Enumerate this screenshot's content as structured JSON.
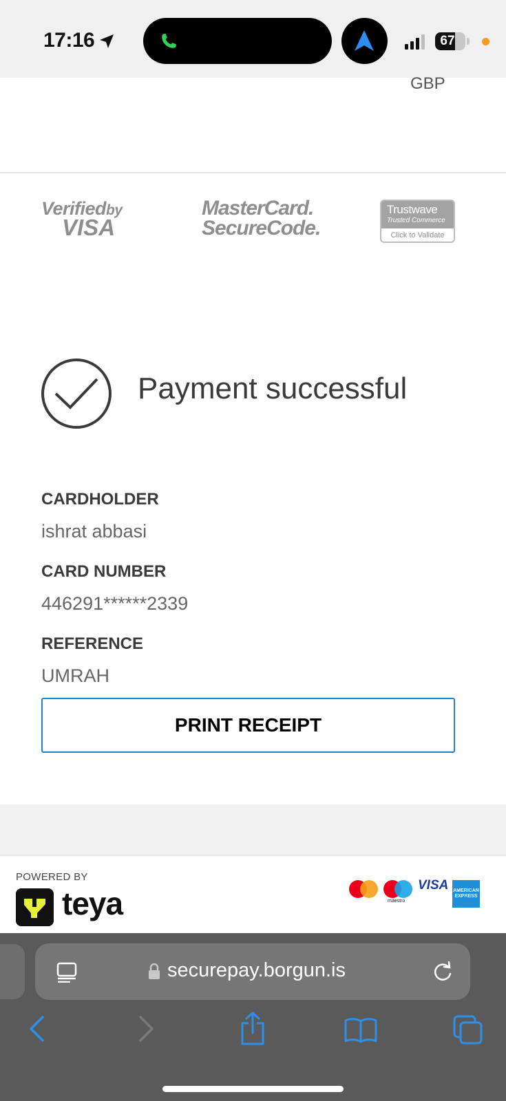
{
  "status_bar": {
    "time": "17:16",
    "battery": "67",
    "battery_level": 0.67,
    "icons": [
      "location-arrow-icon",
      "phone-icon",
      "navigation-icon",
      "signal-icon",
      "battery-icon"
    ]
  },
  "payment": {
    "currency": "GBP",
    "status": "Payment successful",
    "fields": [
      {
        "label": "CARDHOLDER",
        "value": "ishrat abbasi"
      },
      {
        "label": "CARD NUMBER",
        "value": "446291******2339"
      },
      {
        "label": "REFERENCE",
        "value": "UMRAH"
      }
    ],
    "print_label": "PRINT RECEIPT"
  },
  "security_logos": {
    "vbv_line1": "Verified",
    "vbv_by": "by",
    "vbv_line2": "VISA",
    "msc_line1": "MasterCard.",
    "msc_line2": "SecureCode.",
    "trustwave_name": "Trustwave",
    "trustwave_sub": "Trusted Commerce",
    "trustwave_action": "Click to Validate"
  },
  "footer": {
    "powered_by": "POWERED BY",
    "brand": "teya",
    "visa": "VISA",
    "maestro": "maestro",
    "amex_l1": "AMERICAN",
    "amex_l2": "EXPRESS"
  },
  "browser": {
    "url": "securepay.borgun.is",
    "icons": [
      "page-menu-icon",
      "lock-icon",
      "reload-icon",
      "back-icon",
      "forward-icon",
      "share-icon",
      "bookmarks-icon",
      "tabs-icon"
    ]
  },
  "colors": {
    "accent_blue": "#1f83c6",
    "safari_blue": "#2f8fe6",
    "text_dark": "#3a3a3a"
  }
}
